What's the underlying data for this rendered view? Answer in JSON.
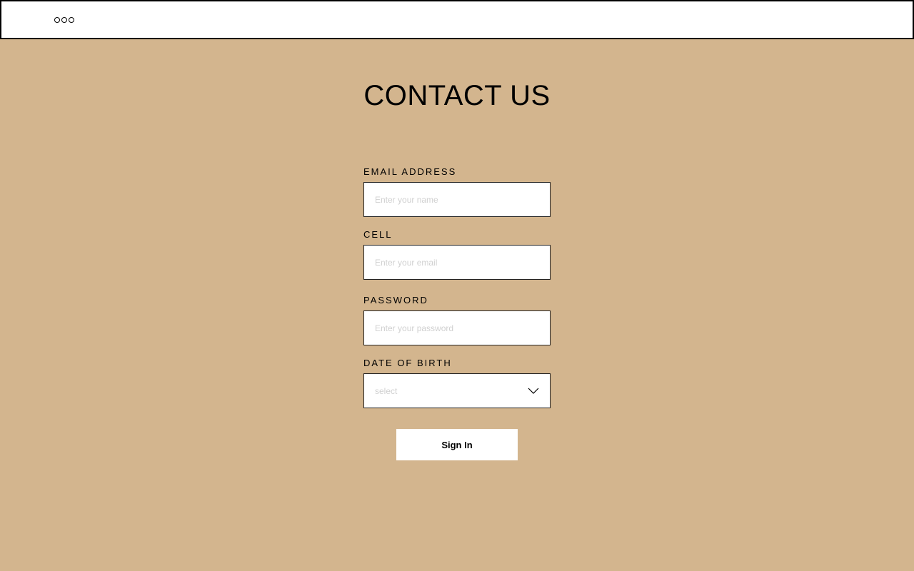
{
  "topbar": {
    "icons": [
      "window-dot-icon",
      "window-dot-icon",
      "window-dot-icon"
    ]
  },
  "page": {
    "title": "CONTACT US"
  },
  "form": {
    "fields": [
      {
        "label": "EMAIL ADDRESS",
        "placeholder": "Enter your name",
        "value": ""
      },
      {
        "label": "CELL",
        "placeholder": "Enter your email",
        "value": ""
      },
      {
        "label": "PASSWORD",
        "placeholder": "Enter your password",
        "value": ""
      }
    ],
    "date_of_birth": {
      "label": "DATE OF BIRTH",
      "selected": "select",
      "icon": "chevron-down-icon"
    },
    "submit_label": "Sign In"
  }
}
